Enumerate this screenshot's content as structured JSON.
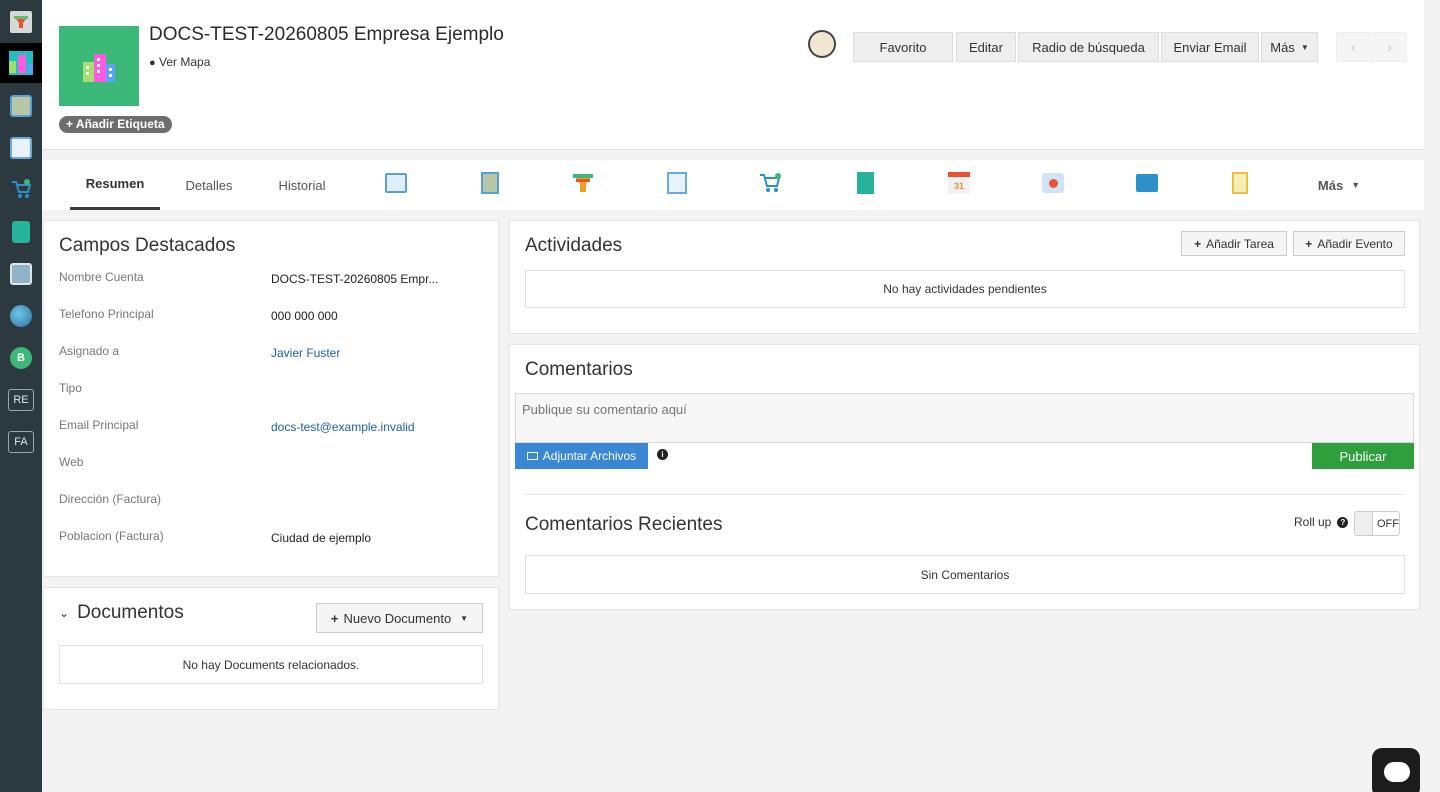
{
  "sidebar": {
    "items": [
      {
        "icon": "funnel-icon",
        "color": "#e8542d"
      },
      {
        "icon": "building-icon",
        "color": "#3cb878"
      },
      {
        "icon": "contact-card-icon",
        "color": "#5aa0d8"
      },
      {
        "icon": "document-edit-icon",
        "color": "#6aa8e0"
      },
      {
        "icon": "cart-icon",
        "color": "#2d90c8"
      },
      {
        "icon": "invoice-icon",
        "color": "#27b39b"
      },
      {
        "icon": "dashboard-icon",
        "color": "#8fb3c9"
      },
      {
        "icon": "globe-icon",
        "color": "#46a0d0"
      },
      {
        "icon": "circle-b-icon",
        "color": "#3cb878",
        "text": "B"
      },
      {
        "icon": "re-icon",
        "text": "RE"
      },
      {
        "icon": "fa-icon",
        "text": "FA"
      }
    ]
  },
  "header": {
    "title": "DOCS-TEST-20260805 Empresa Ejemplo",
    "map_link": "Ver Mapa",
    "tag_button": "Añadir Etiqueta",
    "actions": {
      "favorito": "Favorito",
      "editar": "Editar",
      "radio": "Radio de búsqueda",
      "email": "Enviar Email",
      "mas": "Más"
    }
  },
  "tabs": {
    "resumen": "Resumen",
    "detalles": "Detalles",
    "historial": "Historial",
    "mas": "Más",
    "icons": [
      "meeting-icon",
      "contact-icon",
      "funnel-icon",
      "quote-icon",
      "cart-icon",
      "invoice-icon",
      "calendar-icon",
      "map-pin-icon",
      "email-icon",
      "notes-icon"
    ]
  },
  "campos": {
    "title": "Campos Destacados",
    "fields": [
      {
        "label": "Nombre Cuenta",
        "value": "DOCS-TEST-20260805 Empr..."
      },
      {
        "label": "Telefono Principal",
        "value": "000 000 000"
      },
      {
        "label": "Asignado a",
        "value": "Javier Fuster"
      },
      {
        "label": "Tipo",
        "value": ""
      },
      {
        "label": "Email Principal",
        "value": "docs-test@example.invalid"
      },
      {
        "label": "Web",
        "value": ""
      },
      {
        "label": "Dirección (Factura)",
        "value": ""
      },
      {
        "label": "Poblacion (Factura)",
        "value": "Ciudad de ejemplo"
      }
    ]
  },
  "documentos": {
    "title": "Documentos",
    "new_button": "Nuevo Documento",
    "empty": "No hay Documents relacionados."
  },
  "actividades": {
    "title": "Actividades",
    "add_task": "Añadir Tarea",
    "add_event": "Añadir Evento",
    "empty": "No hay actividades pendientes"
  },
  "comentarios": {
    "title": "Comentarios",
    "placeholder": "Publique su comentario aquí",
    "attach": "Adjuntar Archivos",
    "publish": "Publicar",
    "recent_title": "Comentarios Recientes",
    "rollup_label": "Roll up",
    "toggle_state": "OFF",
    "empty": "Sin Comentarios"
  },
  "colors": {
    "publish": "#2f9f3e",
    "attach": "#3a87d6",
    "record_icon_bg": "#3cb878"
  }
}
